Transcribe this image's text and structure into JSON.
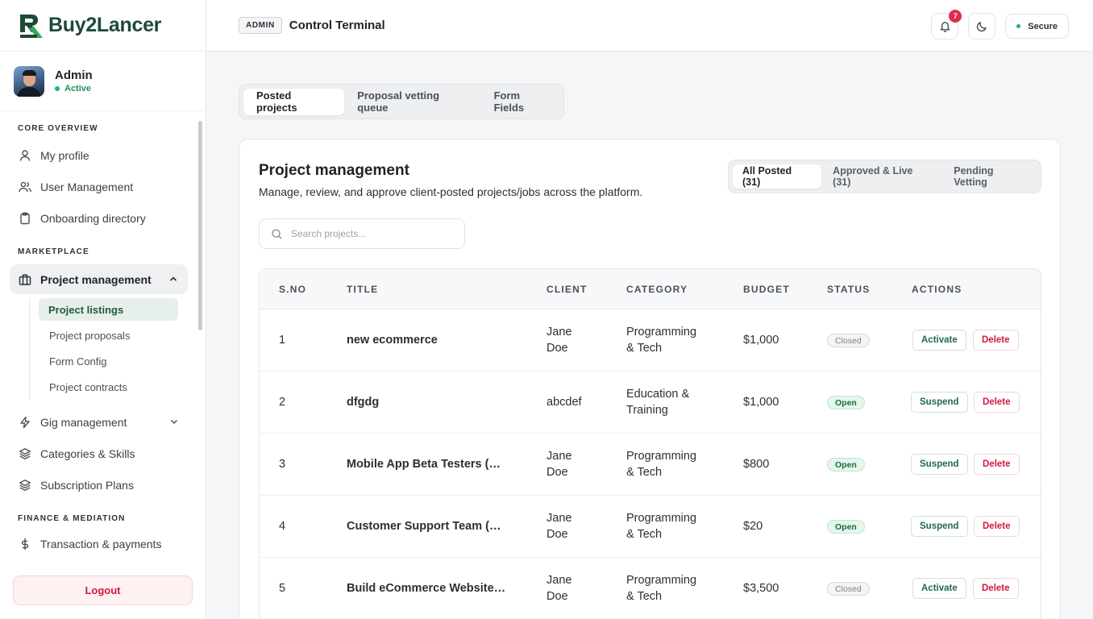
{
  "brand": {
    "name": "Buy2Lancer"
  },
  "user": {
    "name": "Admin",
    "status": "Active"
  },
  "sidebar": {
    "sections": [
      {
        "label": "CORE OVERVIEW"
      },
      {
        "label": "MARKETPLACE"
      },
      {
        "label": "FINANCE & MEDIATION"
      }
    ],
    "items": {
      "my_profile": "My profile",
      "user_management": "User Management",
      "onboarding": "Onboarding directory",
      "project_management": "Project management",
      "gig_management": "Gig management",
      "categories": "Categories & Skills",
      "subscriptions": "Subscription Plans",
      "transactions": "Transaction & payments"
    },
    "sub_items": [
      "Project listings",
      "Project proposals",
      "Form Config",
      "Project contracts"
    ],
    "logout": "Logout"
  },
  "topbar": {
    "badge": "ADMIN",
    "title": "Control Terminal",
    "notifications": "7",
    "secure": "Secure"
  },
  "main_tabs": [
    "Posted projects",
    "Proposal vetting queue",
    "Form Fields"
  ],
  "card": {
    "title": "Project management",
    "subtitle": "Manage, review, and approve client-posted projects/jobs across the platform.",
    "filters": [
      "All Posted (31)",
      "Approved & Live (31)",
      "Pending Vetting"
    ],
    "search_placeholder": "Search projects..."
  },
  "table": {
    "headers": [
      "S.NO",
      "TITLE",
      "CLIENT",
      "CATEGORY",
      "BUDGET",
      "STATUS",
      "ACTIONS"
    ],
    "rows": [
      {
        "sno": "1",
        "title": "new ecommerce",
        "client_1": "Jane",
        "client_2": "Doe",
        "cat_1": "Programming",
        "cat_2": "& Tech",
        "budget": "$1,000",
        "status": "Closed",
        "action": "Activate",
        "delete": "Delete"
      },
      {
        "sno": "2",
        "title": "dfgdg",
        "client_1": "abcdef",
        "client_2": "",
        "cat_1": "Education &",
        "cat_2": "Training",
        "budget": "$1,000",
        "status": "Open",
        "action": "Suspend",
        "delete": "Delete"
      },
      {
        "sno": "3",
        "title": "Mobile App Beta Testers (M…",
        "client_1": "Jane",
        "client_2": "Doe",
        "cat_1": "Programming",
        "cat_2": "& Tech",
        "budget": "$800",
        "status": "Open",
        "action": "Suspend",
        "delete": "Delete"
      },
      {
        "sno": "4",
        "title": "Customer Support Team (M…",
        "client_1": "Jane",
        "client_2": "Doe",
        "cat_1": "Programming",
        "cat_2": "& Tech",
        "budget": "$20",
        "status": "Open",
        "action": "Suspend",
        "delete": "Delete"
      },
      {
        "sno": "5",
        "title": "Build eCommerce Website …",
        "client_1": "Jane",
        "client_2": "Doe",
        "cat_1": "Programming",
        "cat_2": "& Tech",
        "budget": "$3,500",
        "status": "Closed",
        "action": "Activate",
        "delete": "Delete"
      }
    ]
  },
  "colors": {
    "brand_green": "#1d4a36",
    "danger": "#d3183f",
    "success": "#22b36b"
  }
}
